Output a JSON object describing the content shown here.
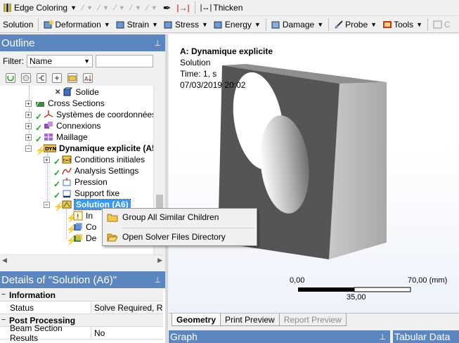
{
  "toolbar1": {
    "edge_coloring": "Edge Coloring",
    "thicken": "Thicken"
  },
  "toolbar2": {
    "solution": "Solution",
    "deformation": "Deformation",
    "strain": "Strain",
    "stress": "Stress",
    "energy": "Energy",
    "damage": "Damage",
    "probe": "Probe",
    "tools": "Tools",
    "more": "C"
  },
  "outline": {
    "title": "Outline",
    "filter_label": "Filter:",
    "filter_value": "Name",
    "tree": {
      "solide": "Solide",
      "cross_sections": "Cross Sections",
      "coord": "Systèmes de coordonnées",
      "connexions": "Connexions",
      "maillage": "Maillage",
      "dynamique": "Dynamique explicite (A5",
      "conditions": "Conditions initiales",
      "analysis": "Analysis Settings",
      "pression": "Pression",
      "support": "Support fixe",
      "solution": "Solution (A6)",
      "child1": "In",
      "child2": "Co",
      "child3": "De"
    }
  },
  "context_menu": {
    "item1": "Group All Similar Children",
    "item2": "Open Solver Files Directory"
  },
  "details": {
    "title": "Details of \"Solution (A6)\"",
    "section_info": "Information",
    "status_label": "Status",
    "status_value": "Solve Required, R...",
    "section_post": "Post Processing",
    "beam_label": "Beam Section Results",
    "beam_value": "No"
  },
  "viewport": {
    "title": "A: Dynamique explicite",
    "subtitle": "Solution",
    "time": "Time: 1, s",
    "date": "07/03/2019 20:02",
    "scale_min": "0,00",
    "scale_max": "70,00 (mm)",
    "scale_mid": "35,00"
  },
  "tabs": {
    "geometry": "Geometry",
    "print_preview": "Print Preview",
    "report_preview": "Report Preview"
  },
  "bottom": {
    "graph": "Graph",
    "tabular": "Tabular Data"
  },
  "colors": {
    "panel_header": "#5c86bf",
    "selection": "#3399ff",
    "check_green": "#2b9a2b",
    "box_front": "#555555"
  }
}
